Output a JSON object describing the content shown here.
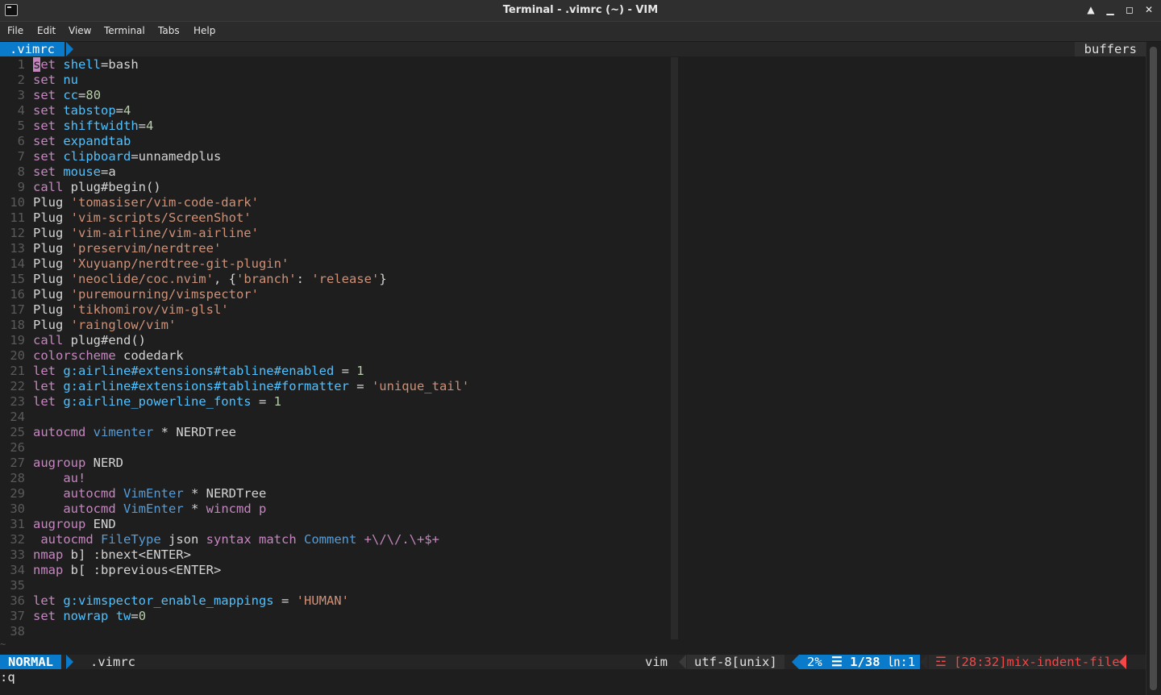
{
  "window": {
    "title": "Terminal - .vimrc (~) - VIM",
    "buttons": [
      "up-arrow-icon",
      "minimize-icon",
      "maximize-icon",
      "close-icon"
    ]
  },
  "menu": [
    "File",
    "Edit",
    "View",
    "Terminal",
    "Tabs",
    "Help"
  ],
  "tabline": {
    "active_tab": ".vimrc",
    "right_label": "buffers"
  },
  "colors": {
    "accent": "#0a7aca",
    "keyword": "#c586c0",
    "string": "#ce9178",
    "number": "#b5cea8",
    "variable": "#4fc1ff",
    "type": "#569cd6",
    "error": "#f44747"
  },
  "lines": [
    [
      [
        "kw",
        "set"
      ],
      [
        "",
        ""
      ],
      [
        "",
        ""
      ],
      [
        "",
        ""
      ]
    ],
    [],
    [],
    [],
    [],
    [],
    [],
    [],
    [],
    [],
    [],
    [],
    [],
    [],
    [],
    [],
    [],
    [],
    [],
    [],
    [],
    [],
    [],
    [],
    [],
    [],
    [],
    [],
    [],
    [],
    [],
    [],
    [],
    [],
    [],
    [],
    [],
    []
  ],
  "code": [
    [
      [
        "kw",
        "set"
      ],
      [
        "t",
        " "
      ],
      [
        "var",
        "shell"
      ],
      [
        "t",
        "=bash"
      ]
    ],
    [
      [
        "kw",
        "set"
      ],
      [
        "t",
        " "
      ],
      [
        "var",
        "nu"
      ]
    ],
    [
      [
        "kw",
        "set"
      ],
      [
        "t",
        " "
      ],
      [
        "var",
        "cc"
      ],
      [
        "t",
        "="
      ],
      [
        "num",
        "80"
      ]
    ],
    [
      [
        "kw",
        "set"
      ],
      [
        "t",
        " "
      ],
      [
        "var",
        "tabstop"
      ],
      [
        "t",
        "="
      ],
      [
        "num",
        "4"
      ]
    ],
    [
      [
        "kw",
        "set"
      ],
      [
        "t",
        " "
      ],
      [
        "var",
        "shiftwidth"
      ],
      [
        "t",
        "="
      ],
      [
        "num",
        "4"
      ]
    ],
    [
      [
        "kw",
        "set"
      ],
      [
        "t",
        " "
      ],
      [
        "var",
        "expandtab"
      ]
    ],
    [
      [
        "kw",
        "set"
      ],
      [
        "t",
        " "
      ],
      [
        "var",
        "clipboard"
      ],
      [
        "t",
        "=unnamedplus"
      ]
    ],
    [
      [
        "kw",
        "set"
      ],
      [
        "t",
        " "
      ],
      [
        "var",
        "mouse"
      ],
      [
        "t",
        "=a"
      ]
    ],
    [
      [
        "kw",
        "call"
      ],
      [
        "t",
        " plug#begin()"
      ]
    ],
    [
      [
        "t",
        "Plug "
      ],
      [
        "str",
        "'tomasiser/vim-code-dark'"
      ]
    ],
    [
      [
        "t",
        "Plug "
      ],
      [
        "str",
        "'vim-scripts/ScreenShot'"
      ]
    ],
    [
      [
        "t",
        "Plug "
      ],
      [
        "str",
        "'vim-airline/vim-airline'"
      ]
    ],
    [
      [
        "t",
        "Plug "
      ],
      [
        "str",
        "'preservim/nerdtree'"
      ]
    ],
    [
      [
        "t",
        "Plug "
      ],
      [
        "str",
        "'Xuyuanp/nerdtree-git-plugin'"
      ]
    ],
    [
      [
        "t",
        "Plug "
      ],
      [
        "str",
        "'neoclide/coc.nvim'"
      ],
      [
        "t",
        ", {"
      ],
      [
        "str",
        "'branch'"
      ],
      [
        "t",
        ": "
      ],
      [
        "str",
        "'release'"
      ],
      [
        "t",
        "}"
      ]
    ],
    [
      [
        "t",
        "Plug "
      ],
      [
        "str",
        "'puremourning/vimspector'"
      ]
    ],
    [
      [
        "t",
        "Plug "
      ],
      [
        "str",
        "'tikhomirov/vim-glsl'"
      ]
    ],
    [
      [
        "t",
        "Plug "
      ],
      [
        "str",
        "'rainglow/vim'"
      ]
    ],
    [
      [
        "kw",
        "call"
      ],
      [
        "t",
        " plug#end()"
      ]
    ],
    [
      [
        "kw",
        "colorscheme"
      ],
      [
        "t",
        " codedark"
      ]
    ],
    [
      [
        "kw",
        "let"
      ],
      [
        "t",
        " "
      ],
      [
        "var",
        "g:airline#extensions#tabline#enabled"
      ],
      [
        "t",
        " = "
      ],
      [
        "num",
        "1"
      ]
    ],
    [
      [
        "kw",
        "let"
      ],
      [
        "t",
        " "
      ],
      [
        "var",
        "g:airline#extensions#tabline#formatter"
      ],
      [
        "t",
        " = "
      ],
      [
        "str",
        "'unique_tail'"
      ]
    ],
    [
      [
        "kw",
        "let"
      ],
      [
        "t",
        " "
      ],
      [
        "var",
        "g:airline_powerline_fonts"
      ],
      [
        "t",
        " = "
      ],
      [
        "num",
        "1"
      ]
    ],
    [],
    [
      [
        "kw",
        "autocmd"
      ],
      [
        "t",
        " "
      ],
      [
        "blue",
        "vimenter"
      ],
      [
        "t",
        " * NERDTree"
      ]
    ],
    [],
    [
      [
        "kw",
        "augroup"
      ],
      [
        "t",
        " NERD"
      ]
    ],
    [
      [
        "t",
        "    "
      ],
      [
        "kw",
        "au!"
      ]
    ],
    [
      [
        "t",
        "    "
      ],
      [
        "kw",
        "autocmd"
      ],
      [
        "t",
        " "
      ],
      [
        "blue",
        "VimEnter"
      ],
      [
        "t",
        " * NERDTree"
      ]
    ],
    [
      [
        "t",
        "    "
      ],
      [
        "kw",
        "autocmd"
      ],
      [
        "t",
        " "
      ],
      [
        "blue",
        "VimEnter"
      ],
      [
        "t",
        " * "
      ],
      [
        "kw",
        "wincmd p"
      ]
    ],
    [
      [
        "kw",
        "augroup"
      ],
      [
        "t",
        " END"
      ]
    ],
    [
      [
        "t",
        " "
      ],
      [
        "kw",
        "autocmd"
      ],
      [
        "t",
        " "
      ],
      [
        "blue",
        "FileType"
      ],
      [
        "t",
        " json "
      ],
      [
        "kw",
        "syntax match"
      ],
      [
        "t",
        " "
      ],
      [
        "blue",
        "Comment"
      ],
      [
        "t",
        " "
      ],
      [
        "kw",
        "+\\/\\/.\\+$+"
      ]
    ],
    [
      [
        "kw",
        "nmap"
      ],
      [
        "t",
        " b] :bnext<ENTER>"
      ]
    ],
    [
      [
        "kw",
        "nmap"
      ],
      [
        "t",
        " b[ :bprevious<ENTER>"
      ]
    ],
    [],
    [
      [
        "kw",
        "let"
      ],
      [
        "t",
        " "
      ],
      [
        "var",
        "g:vimspector_enable_mappings"
      ],
      [
        "t",
        " = "
      ],
      [
        "str",
        "'HUMAN'"
      ]
    ],
    [
      [
        "kw",
        "set"
      ],
      [
        "t",
        " "
      ],
      [
        "var",
        "nowrap"
      ],
      [
        "t",
        " "
      ],
      [
        "var",
        "tw"
      ],
      [
        "t",
        "="
      ],
      [
        "num",
        "0"
      ]
    ],
    []
  ],
  "statusline": {
    "mode": "NORMAL",
    "filename": ".vimrc",
    "filetype": "vim",
    "encoding": "utf-8[unix]",
    "percent": "2%",
    "line_pos": "☰ 1/38",
    "col_pos": "㏑:1",
    "warning": "☲ [28:32]mix-indent-file"
  },
  "cmdline": ":q"
}
